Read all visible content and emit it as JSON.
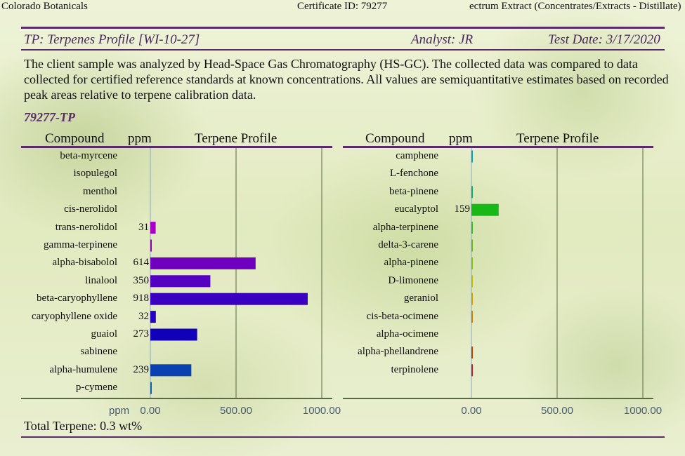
{
  "header": {
    "lab_name": "Colorado Botanicals",
    "certificate": "Certificate ID: 79277",
    "product": "ectrum Extract (Concentrates/Extracts - Distillate)"
  },
  "section": {
    "title": "TP: Terpenes Profile [WI-10-27]",
    "analyst": "Analyst: JR",
    "test_date": "Test Date: 3/17/2020",
    "description": "The client sample was analyzed by Head-Space Gas Chromatography (HS-GC).  The collected data was compared to data collected for certified reference standards at known concentrations.  All values are semiquantitative estimates based on recorded peak areas relative to terpene calibration data.",
    "sample_id": "79277-TP",
    "total": "Total Terpene: 0.3 wt%"
  },
  "columns": {
    "compound": "Compound",
    "ppm": "ppm",
    "profile": "Terpene Profile"
  },
  "chart_data": [
    {
      "type": "bar",
      "orientation": "horizontal",
      "xlabel": "ppm",
      "xlim": [
        0,
        1000
      ],
      "ticks": [
        "0.00",
        "500.00",
        "1000.00"
      ],
      "grid": true,
      "categories": [
        "beta-myrcene",
        "isopulegol",
        "menthol",
        "cis-nerolidol",
        "trans-nerolidol",
        "gamma-terpinene",
        "alpha-bisabolol",
        "linalool",
        "beta-caryophyllene",
        "caryophyllene oxide",
        "guaiol",
        "sabinene",
        "alpha-humulene",
        "p-cymene"
      ],
      "values": [
        0,
        0,
        0,
        0,
        31,
        8,
        614,
        350,
        918,
        32,
        273,
        0,
        239,
        8
      ],
      "labels": [
        "",
        "",
        "",
        "",
        "31",
        "",
        "614",
        "350",
        "918",
        "32",
        "273",
        "",
        "239",
        ""
      ],
      "colors": [
        "#b000c0",
        "#b000c0",
        "#b000c0",
        "#b000c0",
        "#a800c8",
        "#8a00b8",
        "#7000c0",
        "#5400c0",
        "#3a00c0",
        "#2600c0",
        "#1000b8",
        "#0828b0",
        "#0a40b0",
        "#0a60b8"
      ]
    },
    {
      "type": "bar",
      "orientation": "horizontal",
      "xlabel": "",
      "xlim": [
        0,
        1000
      ],
      "ticks": [
        "0.00",
        "500.00",
        "1000.00"
      ],
      "grid": true,
      "categories": [
        "camphene",
        "L-fenchone",
        "beta-pinene",
        "eucalyptol",
        "alpha-terpinene",
        "delta-3-carene",
        "alpha-pinene",
        "D-limonene",
        "geraniol",
        "cis-beta-ocimene",
        "alpha-ocimene",
        "alpha-phellandrene",
        "terpinolene"
      ],
      "values": [
        2,
        0,
        4,
        159,
        3,
        2,
        5,
        6,
        2,
        3,
        0,
        2,
        5
      ],
      "labels": [
        "",
        "",
        "",
        "159",
        "",
        "",
        "",
        "",
        "",
        "",
        "",
        "",
        ""
      ],
      "colors": [
        "#10a0b0",
        "#10a0b0",
        "#10b060",
        "#18b818",
        "#40b820",
        "#70b820",
        "#90c010",
        "#c0c000",
        "#d0a000",
        "#d08000",
        "#d06000",
        "#c04000",
        "#c02020"
      ]
    }
  ]
}
